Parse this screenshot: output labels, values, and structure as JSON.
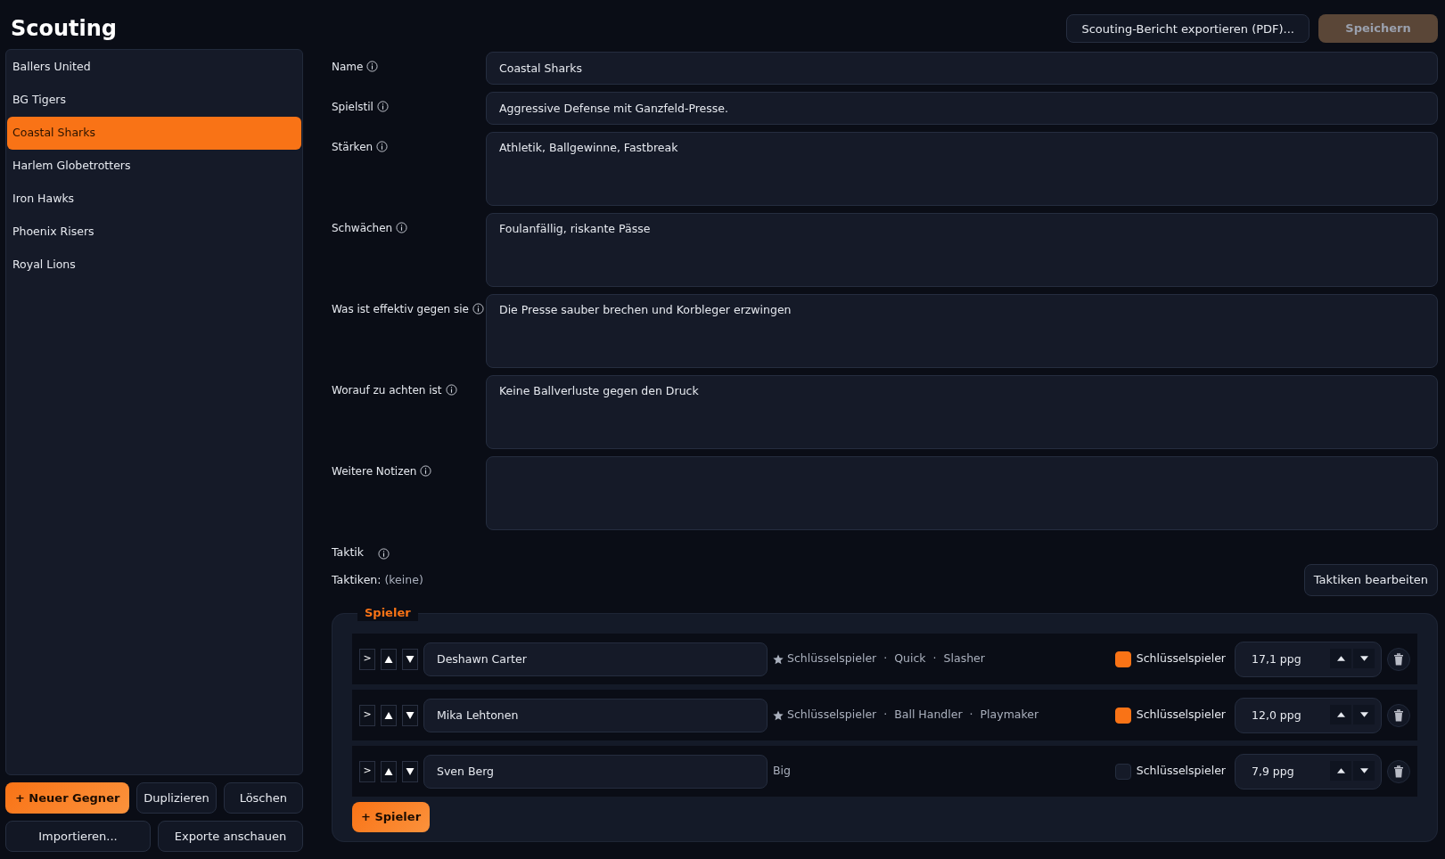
{
  "title": "Scouting",
  "header_buttons": [
    {
      "label": "Scouting-Bericht exportieren (PDF)...",
      "kind": "outline",
      "disabled": false
    },
    {
      "label": "Speichern",
      "kind": "primary",
      "disabled": true
    }
  ],
  "sidebar": {
    "items": [
      {
        "label": "Ballers United",
        "selected": false
      },
      {
        "label": "BG Tigers",
        "selected": false
      },
      {
        "label": "Coastal Sharks",
        "selected": true
      },
      {
        "label": "Harlem Globetrotters",
        "selected": false
      },
      {
        "label": "Iron Hawks",
        "selected": false
      },
      {
        "label": "Phoenix Risers",
        "selected": false
      },
      {
        "label": "Royal Lions",
        "selected": false
      }
    ],
    "buttons": [
      [
        {
          "label": "+ Neuer Gegner",
          "kind": "primary"
        },
        {
          "label": "Duplizieren",
          "kind": "outline"
        },
        {
          "label": "Löschen",
          "kind": "outline"
        }
      ],
      [
        {
          "label": "Importieren...",
          "kind": "outline"
        },
        {
          "label": "Exporte anschauen",
          "kind": "outline"
        }
      ]
    ]
  },
  "form": {
    "fields": [
      {
        "label": "Name",
        "kind": "input",
        "value": "Coastal Sharks"
      },
      {
        "label": "Spielstil",
        "kind": "input",
        "value": "Aggressive Defense mit Ganzfeld-Presse."
      },
      {
        "label": "Stärken",
        "kind": "textarea",
        "value": "Athletik, Ballgewinne, Fastbreak"
      },
      {
        "label": "Schwächen",
        "kind": "textarea",
        "value": "Foulanfällig, riskante Pässe"
      },
      {
        "label": "Was ist effektiv gegen sie",
        "kind": "textarea",
        "value": "Die Presse sauber brechen und Korbleger erzwingen"
      },
      {
        "label": "Worauf zu achten ist",
        "kind": "textarea",
        "value": "Keine Ballverluste gegen den Druck"
      },
      {
        "label": "Weitere Notizen",
        "kind": "textarea"
      }
    ],
    "tactic_label": "Taktik",
    "tactics_label": "Taktiken:",
    "tactics_value": "(keine)",
    "tactics_button": "Taktiken bearbeiten"
  },
  "players": {
    "legend": "Spieler",
    "rows": [
      {
        "expand": ">",
        "name": "Deshawn Carter",
        "tags": [
          {
            "label": "Schlüsselspieler",
            "kind": "key"
          },
          {
            "label": "Quick",
            "kind": "role"
          },
          {
            "label": "Slasher",
            "kind": "role"
          }
        ],
        "checked": true,
        "check_label": "Schlüsselspieler",
        "points": "17,1 ppg"
      },
      {
        "expand": ">",
        "name": "Mika Lehtonen",
        "tags": [
          {
            "label": "Schlüsselspieler",
            "kind": "key"
          },
          {
            "label": "Ball Handler",
            "kind": "role"
          },
          {
            "label": "Playmaker",
            "kind": "role"
          }
        ],
        "checked": true,
        "check_label": "Schlüsselspieler",
        "points": "12,0 ppg"
      },
      {
        "expand": ">",
        "name": "Sven Berg",
        "tags": [
          {
            "label": "Big",
            "kind": "role"
          }
        ],
        "checked": false,
        "check_label": "Schlüsselspieler",
        "points": "7,9 ppg"
      }
    ],
    "separator": "·",
    "add_button": "+ Spieler"
  }
}
